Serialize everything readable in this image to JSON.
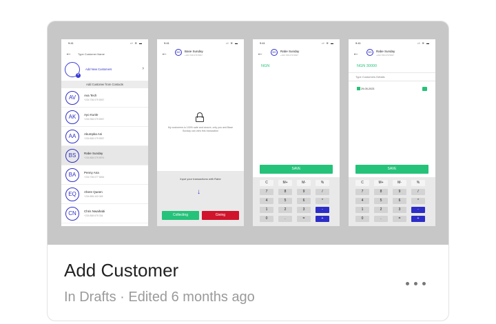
{
  "card": {
    "title": "Add Customer",
    "subtitle": "In Drafts · Edited 6 months ago"
  },
  "status_bar": {
    "time": "9:41",
    "signal": "ıl ≋ ▬"
  },
  "screen1": {
    "search_placeholder": "Type Customer Name",
    "add_new_label": "Add New Customers",
    "contacts_header": "Add Customer from Contacts",
    "contacts": [
      {
        "initials": "AV",
        "name": "Ava Tech",
        "phone": "+234 706 079 5937"
      },
      {
        "initials": "AK",
        "name": "Ayo Kunle",
        "phone": "+234 906 079 5937"
      },
      {
        "initials": "AA",
        "name": "Akumpka Ani",
        "phone": "+234 806 079 5937"
      },
      {
        "initials": "BS",
        "name": "Rabe Sunday",
        "phone": "+234 806 079 5974"
      },
      {
        "initials": "BA",
        "name": "Penny Ana",
        "phone": "+234 706 077 5454"
      },
      {
        "initials": "EQ",
        "name": "Ahere Queen",
        "phone": "+234 806 443 345"
      },
      {
        "initials": "CN",
        "name": "Chris Nwaihabi",
        "phone": "+234 806 675 334"
      }
    ]
  },
  "screen2": {
    "header_name": "Base Sunday",
    "header_sub": "+234 706 079 5937",
    "avatar_initials": "BS",
    "privacy_message": "My customers is 100% safe and secure, only you and Base Sunday can view this transaction",
    "hint": "Input your transactions with Rabe",
    "collect_label": "Collecting",
    "give_label": "Giving"
  },
  "screen3": {
    "header_name": "Rabe Sunday",
    "header_sub": "+234 706 079 5937",
    "avatar_initials": "BS",
    "amount": "NGN",
    "save_label": "SAVE"
  },
  "screen4": {
    "header_name": "Rabe Sunday",
    "header_sub": "+234 706 079 5937",
    "avatar_initials": "BS",
    "amount": "NGN  30000",
    "detail_placeholder": "Type Customers Details",
    "date": "29-05-2023",
    "save_label": "SAVE"
  },
  "keypad": {
    "rows": [
      [
        "C",
        "M+",
        "M-",
        "%"
      ],
      [
        "7",
        "8",
        "9",
        "/"
      ],
      [
        "4",
        "5",
        "6",
        "*"
      ],
      [
        "1",
        "2",
        "3",
        "-"
      ],
      [
        "0",
        ".",
        "=",
        "+"
      ]
    ]
  },
  "icons": {
    "back": "arrow-left-icon",
    "more": "more-horizontal-icon",
    "lock": "lock-icon",
    "calendar": "calendar-icon",
    "camera": "camera-icon"
  },
  "colors": {
    "accent_green": "#25c27a",
    "accent_red": "#d0142c",
    "accent_blue": "#2d2dc8",
    "thumbnail_bg": "#c7c7c7"
  }
}
